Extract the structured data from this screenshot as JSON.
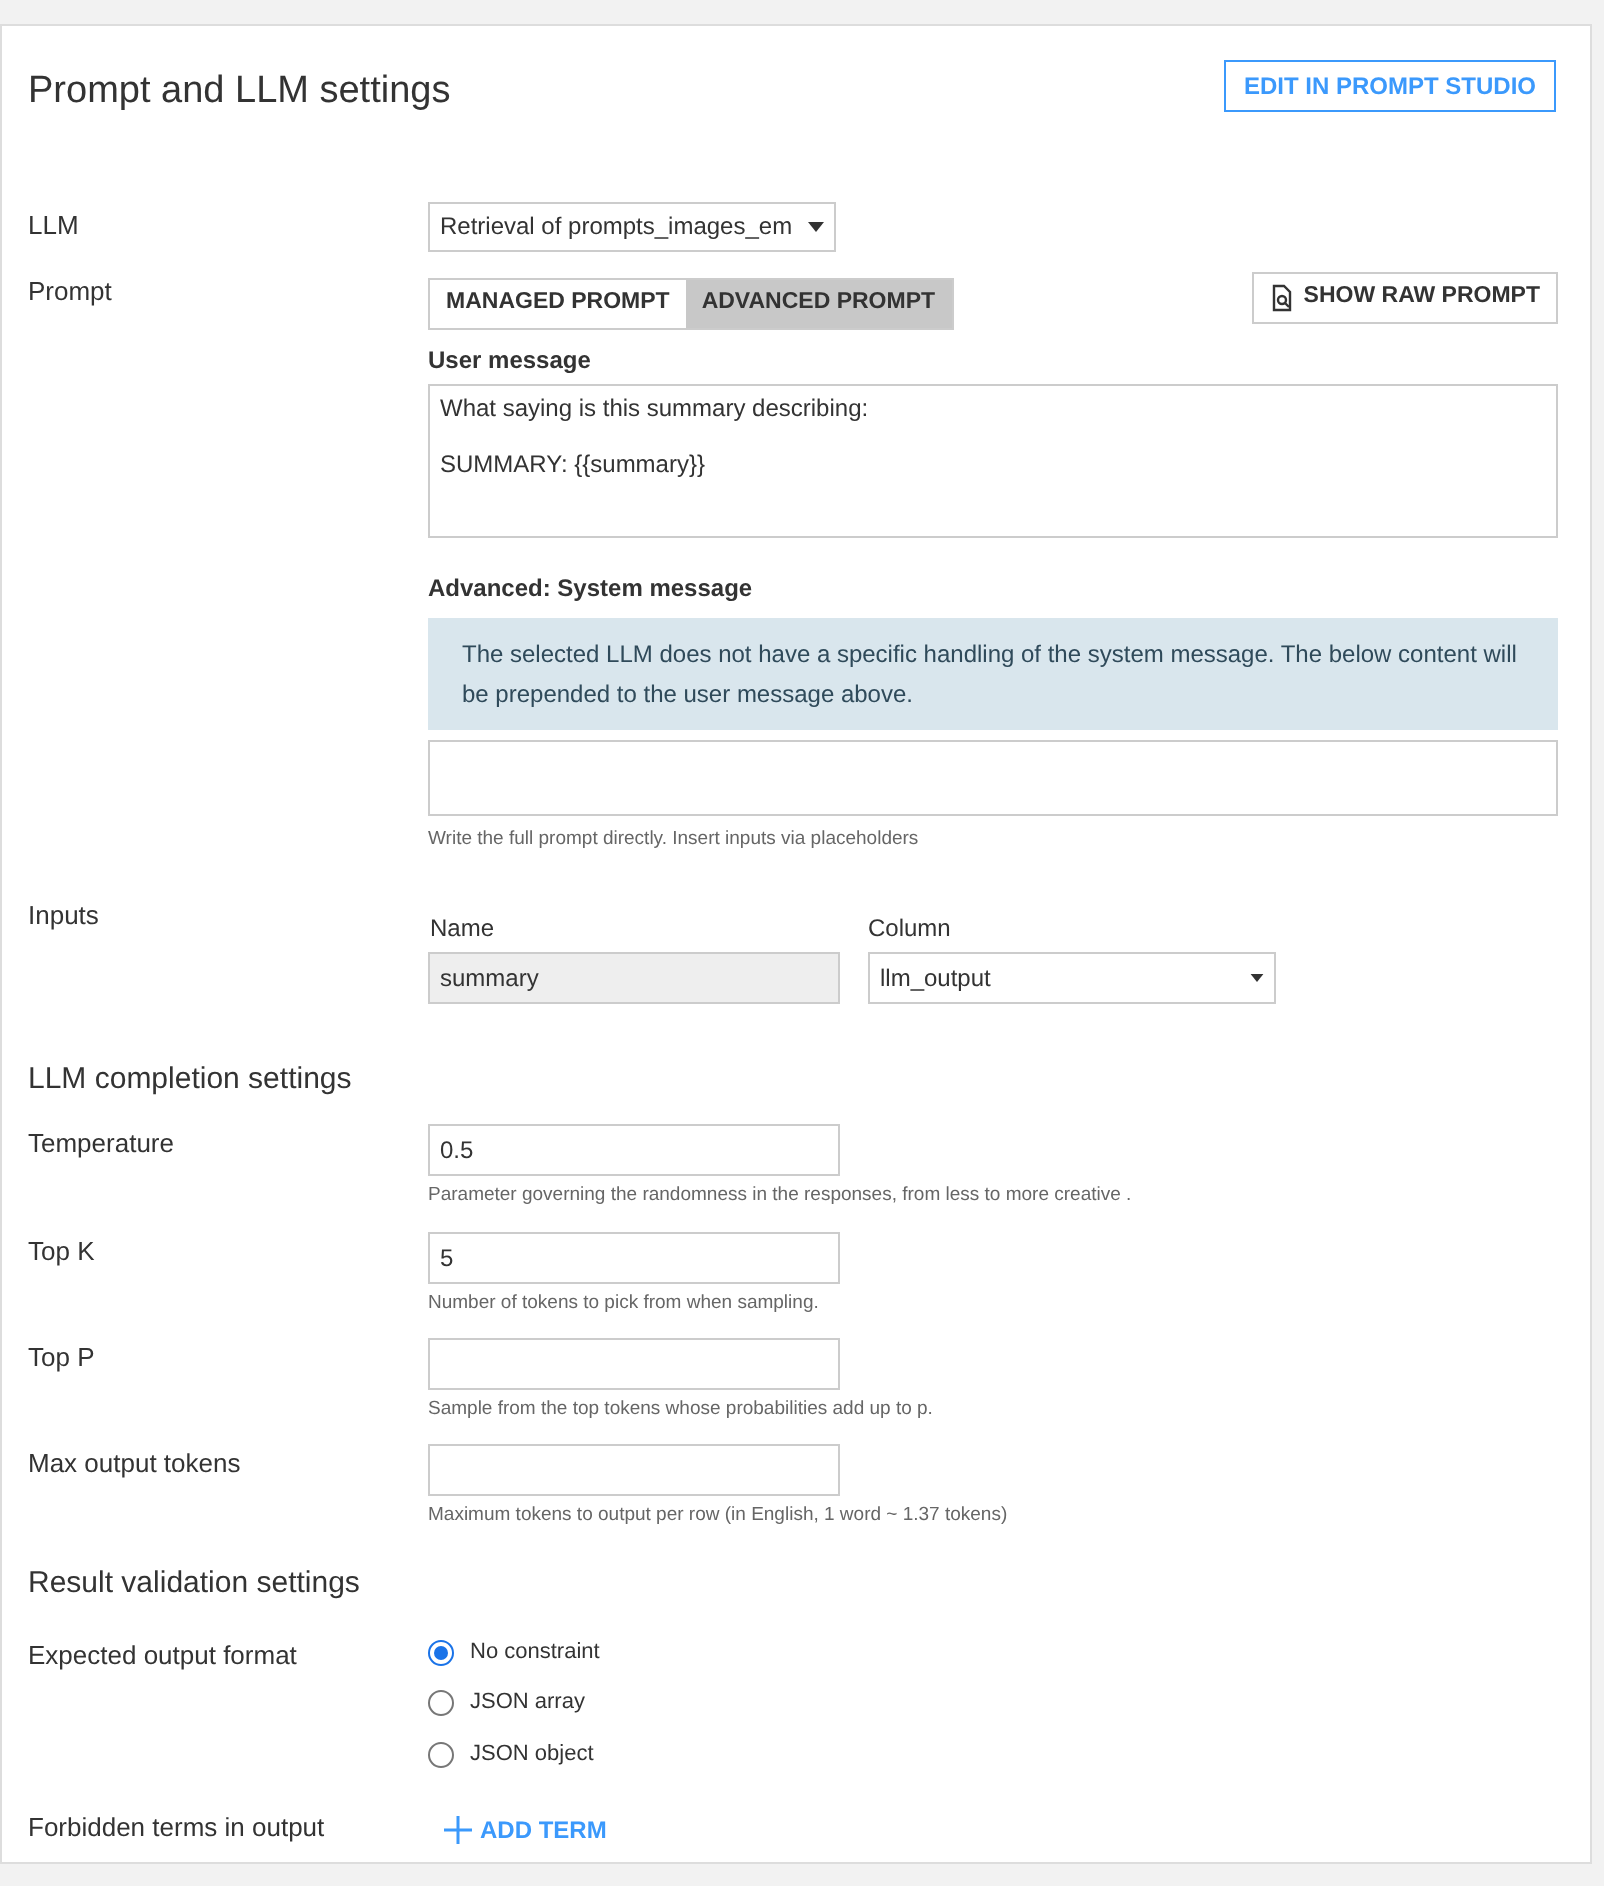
{
  "title": "Prompt and LLM settings",
  "edit_button": "EDIT IN PROMPT STUDIO",
  "llm": {
    "label": "LLM",
    "value": "Retrieval of prompts_images_em"
  },
  "prompt": {
    "label": "Prompt",
    "tabs": [
      {
        "label": "MANAGED PROMPT",
        "selected": false
      },
      {
        "label": "ADVANCED PROMPT",
        "selected": true
      }
    ],
    "raw_button": "SHOW RAW PROMPT",
    "user_message": {
      "label": "User message",
      "lines": [
        "What saying is this summary describing:",
        "SUMMARY: {{summary}}"
      ]
    },
    "system_message": {
      "label": "Advanced: System message",
      "notice": "The selected LLM does not have a specific handling of the system message. The below content will be prepended to the user message above.",
      "hint": "Write the full prompt directly. Insert inputs via placeholders"
    }
  },
  "inputs": {
    "label": "Inputs",
    "name_header": "Name",
    "column_header": "Column",
    "name": "summary",
    "column": "llm_output"
  },
  "completion": {
    "heading": "LLM completion settings",
    "fields": [
      {
        "label": "Temperature",
        "value": "0.5",
        "hint": "Parameter governing the randomness in the responses, from less to more creative ."
      },
      {
        "label": "Top K",
        "value": "5",
        "hint": "Number of tokens to pick from when sampling."
      },
      {
        "label": "Top P",
        "hint": "Sample from the top tokens whose probabilities add up to p."
      },
      {
        "label": "Max output tokens",
        "hint": "Maximum tokens to output per row (in English, 1 word ~ 1.37 tokens)"
      }
    ]
  },
  "validation": {
    "heading": "Result validation settings",
    "format_label": "Expected output format",
    "options": [
      {
        "label": "No constraint",
        "selected": true
      },
      {
        "label": "JSON array",
        "selected": false
      },
      {
        "label": "JSON object",
        "selected": false
      }
    ],
    "forbidden_label": "Forbidden terms in output",
    "add_button": "ADD TERM"
  }
}
